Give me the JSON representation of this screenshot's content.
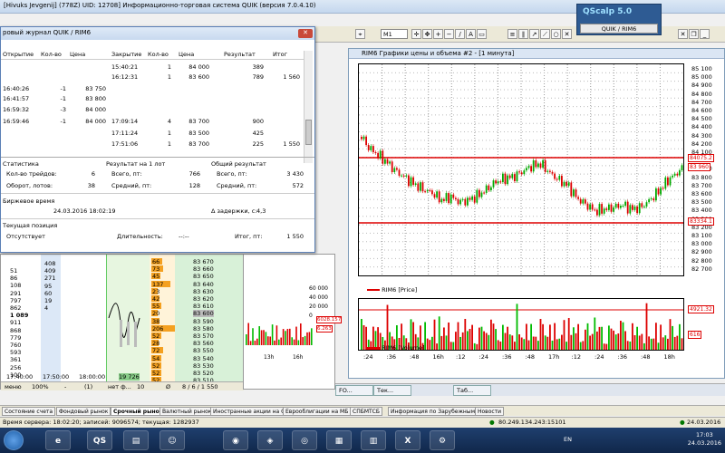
{
  "titlebar": {
    "text": "[Hivuks Jevgenij] (778Z) UID: 12708] Информационно-торговая система QUIK (версия 7.0.4.10)"
  },
  "qscalp": {
    "name": "QScalp 5.0",
    "button": "QUIK / RIM6"
  },
  "toolbar": {
    "interval": "M1"
  },
  "journal": {
    "title": "ровый журнал QUIK / RIM6",
    "subtitle": "/ RIM6",
    "headers": [
      "Открытие",
      "Кол-во",
      "Цена",
      "Закрытие",
      "Кол-во",
      "Цена",
      "Результат",
      "Итог"
    ],
    "rows": [
      [
        "",
        "",
        "",
        "15:40:21",
        "1",
        "84 000",
        "389",
        ""
      ],
      [
        "",
        "",
        "",
        "16:12:31",
        "1",
        "83 600",
        "789",
        "1 560"
      ],
      [
        "16:40:26",
        "-1",
        "83 750",
        "",
        "",
        "",
        "",
        ""
      ],
      [
        "16:41:57",
        "-1",
        "83 800",
        "",
        "",
        "",
        "",
        ""
      ],
      [
        "16:59:32",
        "-3",
        "84 000",
        "",
        "",
        "",
        "",
        ""
      ],
      [
        "16:59:46",
        "-1",
        "84 000",
        "17:09:14",
        "4",
        "83 700",
        "900",
        ""
      ],
      [
        "",
        "",
        "",
        "17:11:24",
        "1",
        "83 500",
        "425",
        ""
      ],
      [
        "",
        "",
        "",
        "17:51:06",
        "1",
        "83 700",
        "225",
        "1 550"
      ]
    ],
    "stats_title": "Статистика",
    "result_lot_title": "Результат на 1 лот",
    "total_result_title": "Общий результат",
    "stats": [
      [
        "Кол-во трейдов:",
        "6"
      ],
      [
        "Оборот, лотов:",
        "38"
      ]
    ],
    "per_lot": [
      [
        "Всего, пт:",
        "766"
      ],
      [
        "Средний, пт:",
        "128"
      ]
    ],
    "total": [
      [
        "Всего, пт:",
        "3 430"
      ],
      [
        "Средний, пт:",
        "572"
      ]
    ],
    "exchange_time_title": "Биржевое время",
    "exchange_time": "24.03.2016 18:02:19",
    "delay_label": "Δ задержки, с:",
    "delay": "4,3",
    "position_title": "Текущая позиция",
    "position_state": "Отсутствует",
    "duration_label": "Длительность:",
    "duration": "--:--",
    "result_label": "Итог, пт:",
    "result": "1 550"
  },
  "chartwin": {
    "title": "RIM6 Графики цены и объема #2 - [1 минута]",
    "price_legend": "RIM6 [Price]",
    "volume_legend": "RIM6 [Volume]",
    "price_labels": [
      "85 100",
      "85 000",
      "84 900",
      "84 800",
      "84 700",
      "84 600",
      "84 500",
      "84 400",
      "84 300",
      "84 200",
      "84 100",
      "84 000",
      "83 900",
      "83 800",
      "83 700",
      "83 600",
      "83 500",
      "83 400",
      "83 300",
      "83 200",
      "83 100",
      "83 000",
      "82 900",
      "82 800",
      "82 700"
    ],
    "upper_line": "84075.2",
    "last_price": "83 960",
    "lower_line": "83334.1",
    "lower_left": "83 940",
    "vol_labels": [
      "6000",
      "4000",
      "2000"
    ],
    "vol_high": "4921.32",
    "vol_last": "616",
    "time_labels": [
      ":24",
      ":36",
      ":48",
      "16h",
      ":12",
      ":24",
      ":36",
      ":48",
      "17h",
      ":12",
      ":24",
      ":36",
      ":48",
      "18h"
    ]
  },
  "leftpanel": {
    "volumes_left": [
      "51",
      "86",
      "108",
      "291",
      "797",
      "862",
      "1 089",
      "911",
      "868",
      "779",
      "760",
      "593",
      "361",
      "256",
      "100"
    ],
    "volumes_right": [
      "408",
      "409",
      "271",
      "95",
      "60",
      "19",
      "4"
    ],
    "prices": [
      "83 670",
      "83 660",
      "83 650",
      "83 640",
      "83 630",
      "83 620",
      "83 610",
      "83 600",
      "83 590",
      "83 580",
      "83 570",
      "83 560",
      "83 550",
      "83 540",
      "83 530",
      "83 520",
      "83 510"
    ],
    "sizes": [
      "66",
      "73",
      "45",
      "137",
      "23",
      "42",
      "55",
      "20",
      "38",
      "206",
      "52",
      "28",
      "72",
      "54",
      "52",
      "52",
      "52"
    ],
    "bottom_times": [
      "17:40:00",
      "17:50:00",
      "18:00:00"
    ],
    "bottom_vol": "19 726",
    "footer": [
      "меню",
      "100%",
      "-",
      "(1)",
      "нет ф...",
      "10",
      "Ø",
      "8 / 6 / 1 550"
    ]
  },
  "smallchart": {
    "labels": [
      "60 000",
      "40 000",
      "20 000",
      "0"
    ],
    "vals": [
      "6028.157",
      "6.263"
    ],
    "time_labels": [
      "13h",
      "16h"
    ]
  },
  "mdi_tabs": [
    "FO...",
    "Тек...",
    "Таб..."
  ],
  "bottom_tabs": [
    "Состояние счета",
    "Фондовый рынок",
    "Срочный рынок",
    "Валютный рынок",
    "Иностранные акции на СПБ",
    "Еврооблигации на МБ",
    "СПБМТСБ",
    "Информация по Зарубежным ранкам",
    "Новости"
  ],
  "status": {
    "server_time": "Время сервера: 18:02:20; записей: 9096574; текущая: 1282937",
    "ip": "80.249.134.243:15101",
    "date": "24.03.2016"
  },
  "taskbar": {
    "lang": "EN",
    "time": "17:03",
    "date": "24.03.2016",
    "apps": [
      "e",
      "QS",
      "▤",
      "☺",
      "◉",
      "◈",
      "◎",
      "▦",
      "▥",
      "X",
      "⚙"
    ]
  }
}
